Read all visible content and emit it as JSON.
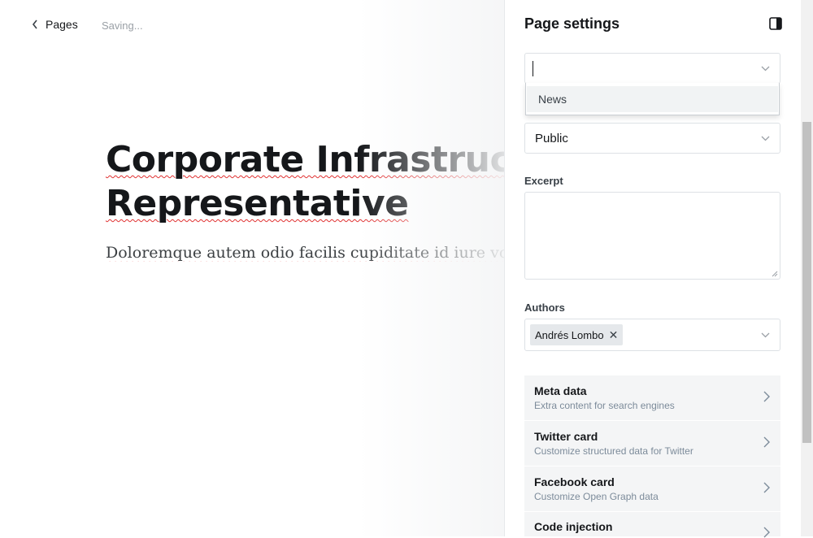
{
  "header": {
    "back_label": "Pages",
    "status": "Saving..."
  },
  "editor": {
    "title_line1": "Corporate Infrastructure",
    "title_line2": "Representative",
    "body": "Doloremque autem odio facilis cupiditate id iure voluptatem"
  },
  "settings": {
    "title": "Page settings",
    "tags_dropdown_option": "News",
    "visibility_value": "Public",
    "excerpt_label": "Excerpt",
    "authors_label": "Authors",
    "author_chip": "Andrés Lombo",
    "author_chip_remove": "✕",
    "nav": [
      {
        "title": "Meta data",
        "subtitle": "Extra content for search engines"
      },
      {
        "title": "Twitter card",
        "subtitle": "Customize structured data for Twitter"
      },
      {
        "title": "Facebook card",
        "subtitle": "Customize Open Graph data"
      },
      {
        "title": "Code injection",
        "subtitle": ""
      }
    ]
  },
  "icons": {
    "back": "chevron-left-icon",
    "panel_toggle": "sidebar-toggle-icon",
    "caret": "chevron-down-icon",
    "nav": "chevron-right-icon"
  },
  "colors": {
    "text": "#15171a",
    "muted": "#7c8b9a",
    "row_bg": "#f4f5f6",
    "spellcheck": "#e03131"
  }
}
